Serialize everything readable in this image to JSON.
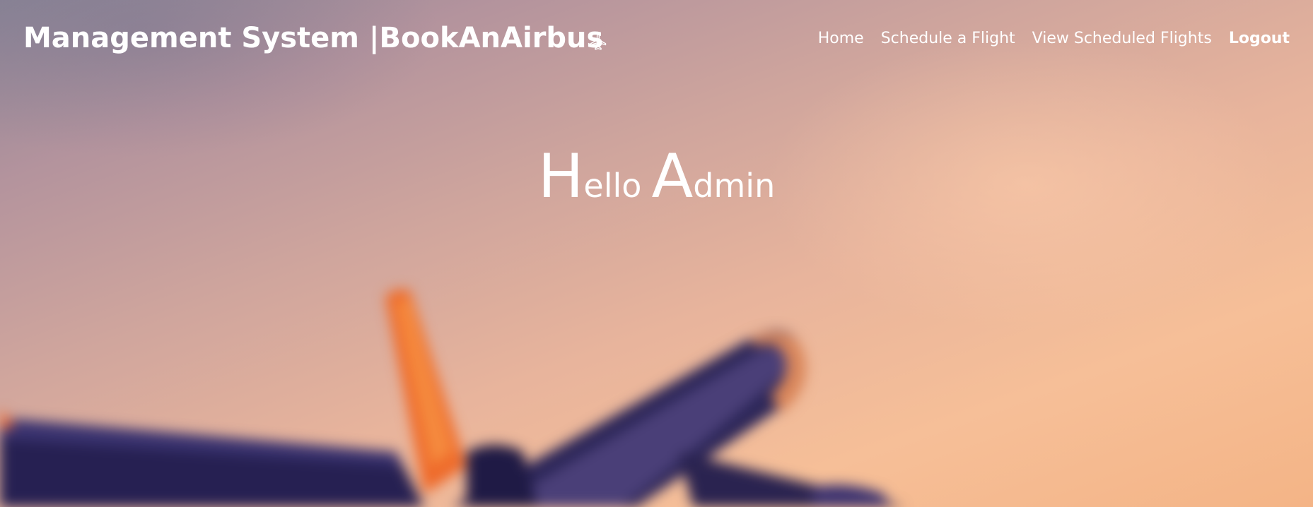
{
  "navbar": {
    "brand": "Management System |BookAnAirbus",
    "brand_icon": "airplane-icon",
    "links": [
      {
        "label": "Home"
      },
      {
        "label": "Schedule a Flight"
      },
      {
        "label": "View Scheduled Flights"
      },
      {
        "label": "Logout"
      }
    ]
  },
  "hero": {
    "word1_initial": "H",
    "word1_rest": "ello",
    "word2_initial": "A",
    "word2_rest": "dmin"
  },
  "background": {
    "image": "blurred-airplane-sunset",
    "colors": [
      "#8c8596",
      "#cfa59d",
      "#f6bf98",
      "#2a2350",
      "#f06a2c"
    ]
  }
}
